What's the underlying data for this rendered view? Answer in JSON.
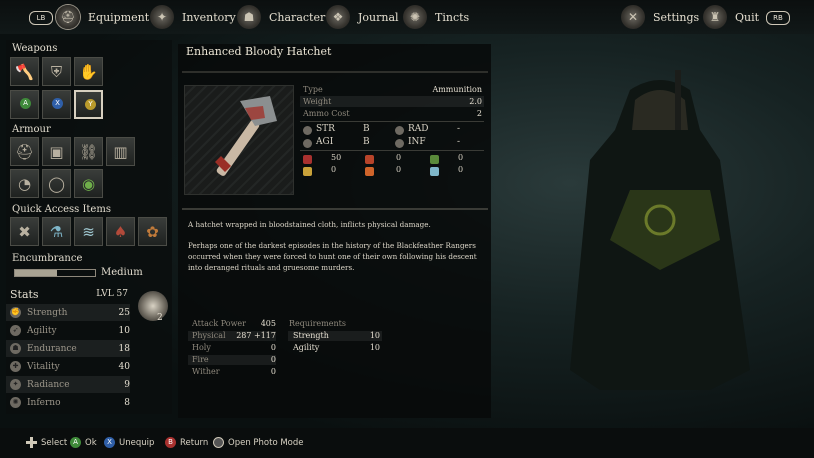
{
  "topbar": {
    "lb": "LB",
    "rb": "RB",
    "nav": [
      {
        "label": "Equipment",
        "icon": "helmet-icon"
      },
      {
        "label": "Inventory",
        "icon": "bag-icon"
      },
      {
        "label": "Character",
        "icon": "character-icon"
      },
      {
        "label": "Journal",
        "icon": "journal-icon"
      },
      {
        "label": "Tincts",
        "icon": "tincts-icon"
      }
    ],
    "settings": "Settings",
    "quit": "Quit"
  },
  "left": {
    "weapons_title": "Weapons",
    "armour_title": "Armour",
    "quick_title": "Quick Access Items",
    "encumbrance_title": "Encumbrance",
    "encumbrance_level": "Medium",
    "encumbrance_fill": 0.52,
    "weapon_badges": [
      "A",
      "X",
      "Y"
    ],
    "stats_title": "Stats",
    "level": "LVL 57",
    "stats": [
      {
        "name": "Strength",
        "value": "25"
      },
      {
        "name": "Agility",
        "value": "10"
      },
      {
        "name": "Endurance",
        "value": "18"
      },
      {
        "name": "Vitality",
        "value": "40"
      },
      {
        "name": "Radiance",
        "value": "9"
      },
      {
        "name": "Inferno",
        "value": "8"
      }
    ],
    "skull_count": "2"
  },
  "item": {
    "title": "Enhanced Bloody Hatchet",
    "type_label": "Type",
    "type_value": "Ammunition",
    "weight_label": "Weight",
    "weight_value": "2.0",
    "ammo_label": "Ammo Cost",
    "ammo_value": "2",
    "scaling": [
      {
        "label": "STR",
        "value": "B"
      },
      {
        "label": "RAD",
        "value": "-"
      },
      {
        "label": "AGI",
        "value": "B"
      },
      {
        "label": "INF",
        "value": "-"
      }
    ],
    "damage_row1": [
      "50",
      "0",
      "0"
    ],
    "damage_row2": [
      "0",
      "0",
      "0"
    ],
    "desc1": "A hatchet wrapped in bloodstained cloth, inflicts physical damage.",
    "desc2": "Perhaps one of the darkest episodes in the history of the Blackfeather Rangers occurred when they were forced to hunt one of their own following his descent into deranged rituals and gruesome murders.",
    "attack_power_label": "Attack Power",
    "attack_power_value": "405",
    "attack": [
      {
        "name": "Physical",
        "value": "287 +117"
      },
      {
        "name": "Holy",
        "value": "0"
      },
      {
        "name": "Fire",
        "value": "0"
      },
      {
        "name": "Wither",
        "value": "0"
      }
    ],
    "requirements_label": "Requirements",
    "requirements": [
      {
        "name": "Strength",
        "value": "10"
      },
      {
        "name": "Agility",
        "value": "10"
      }
    ]
  },
  "bottombar": {
    "select": "Select",
    "ok": "Ok",
    "unequip": "Unequip",
    "return": "Return",
    "photo": "Open Photo Mode",
    "btn_a": "A",
    "btn_x": "X",
    "btn_b": "B",
    "btn_y": "Y"
  },
  "colors": {
    "btn_a": "#3f8a3a",
    "btn_x": "#2f5fa8",
    "btn_b": "#a8312f",
    "btn_y": "#b99a2b"
  }
}
